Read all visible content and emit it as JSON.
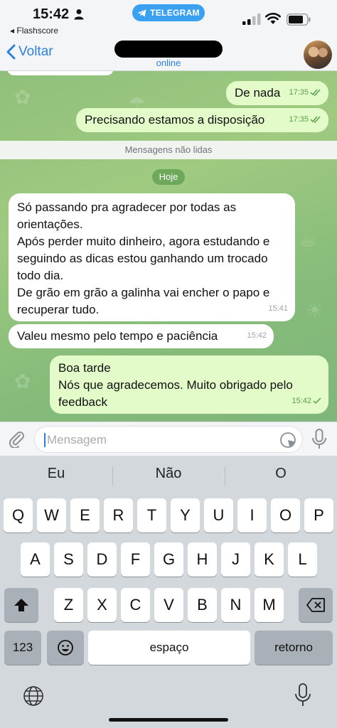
{
  "status_bar": {
    "time": "15:42",
    "back_app": "◂ Flashscore",
    "pill_label": "TELEGRAM",
    "icons": [
      "person-icon",
      "telegram-icon",
      "signal-icon",
      "wifi-icon",
      "battery-icon"
    ]
  },
  "nav": {
    "back_label": "Voltar",
    "status": "online",
    "name": ""
  },
  "chat": {
    "unread_banner": "Mensagens não lidas",
    "date_chip": "Hoje",
    "messages": [
      {
        "direction": "out",
        "text": "De nada",
        "time": "17:35",
        "read": true
      },
      {
        "direction": "out",
        "text": "Precisando estamos a disposição",
        "time": "17:35",
        "read": true
      },
      {
        "direction": "in",
        "text": "Só passando pra agradecer por todas as orientações.\nApós perder muito dinheiro, agora estudando e seguindo as dicas estou ganhando um trocado todo dia.\nDe grão em grão a galinha vai encher o papo e recuperar tudo.",
        "time": "15:41"
      },
      {
        "direction": "in",
        "text": "Valeu mesmo pelo tempo e paciência",
        "time": "15:42"
      },
      {
        "direction": "out",
        "text": "Boa tarde\nNós que agradecemos. Muito obrigado pelo feedback",
        "time": "15:42",
        "read": false
      }
    ]
  },
  "composer": {
    "placeholder": "Mensagem"
  },
  "keyboard": {
    "suggestions": [
      "Eu",
      "Não",
      "O"
    ],
    "row1": [
      "Q",
      "W",
      "E",
      "R",
      "T",
      "Y",
      "U",
      "I",
      "O",
      "P"
    ],
    "row2": [
      "A",
      "S",
      "D",
      "F",
      "G",
      "H",
      "J",
      "K",
      "L"
    ],
    "row3": [
      "Z",
      "X",
      "C",
      "V",
      "B",
      "N",
      "M"
    ],
    "numbers_label": "123",
    "space_label": "espaço",
    "return_label": "retorno"
  },
  "colors": {
    "accent": "#2f7fe0",
    "outgoing_bubble": "#e2fbc9",
    "incoming_bubble": "#ffffff",
    "chat_background": "#8fc07a",
    "telegram_pill": "#3aa0f0"
  }
}
